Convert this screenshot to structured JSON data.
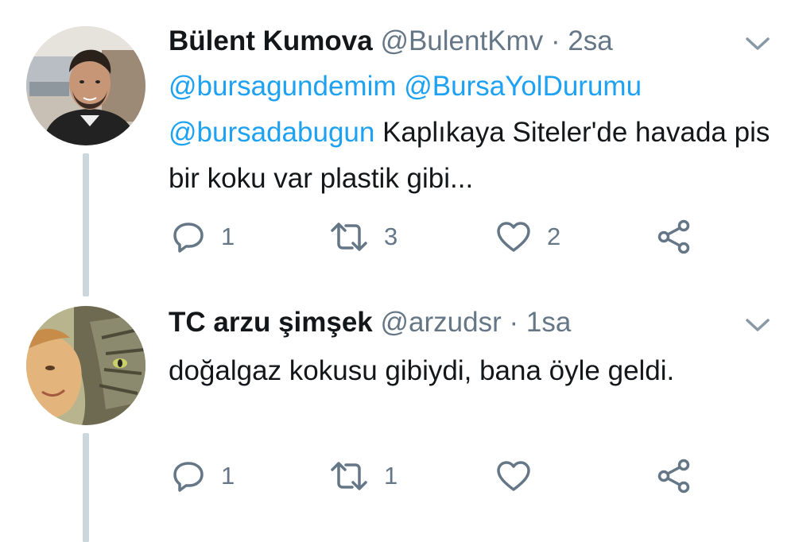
{
  "tweets": [
    {
      "author_name": "Bülent Kumova",
      "handle": "@BulentKmv",
      "separator": "·",
      "time": "2sa",
      "mentions": [
        "@bursagundemim",
        "@BursaYolDurumu",
        "@bursadabugun"
      ],
      "text": "Kaplıkaya Siteler'de havada pis bir koku var plastik gibi...",
      "replies": "1",
      "retweets": "3",
      "likes": "2",
      "avatar_icon": "profile-photo-man"
    },
    {
      "author_name": "TC arzu şimşek",
      "handle": "@arzudsr",
      "separator": "·",
      "time": "1sa",
      "mentions": [],
      "text": "doğalgaz kokusu gibiydi, bana öyle geldi.",
      "replies": "1",
      "retweets": "1",
      "likes": "",
      "avatar_icon": "profile-photo-woman-cat"
    }
  ],
  "icons": {
    "reply": "reply-icon",
    "retweet": "retweet-icon",
    "like": "heart-icon",
    "share": "share-icon",
    "menu": "chevron-down-icon"
  },
  "colors": {
    "link": "#1da1f2",
    "secondary_text": "#657786",
    "primary_text": "#14171a",
    "thread_line": "#ccd6dd"
  }
}
